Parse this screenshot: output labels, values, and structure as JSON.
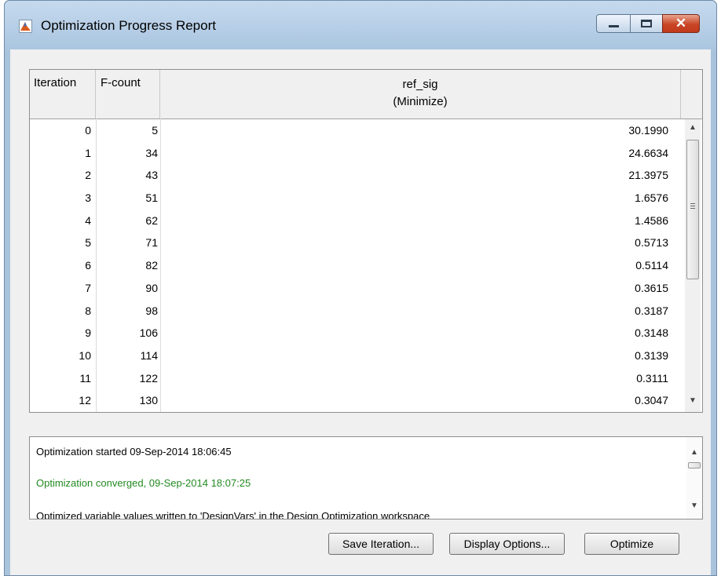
{
  "window": {
    "title": "Optimization Progress Report",
    "title_icon": "matlab-logo-icon",
    "controls": {
      "minimize_icon": "minimize-icon",
      "maximize_icon": "maximize-icon",
      "close_icon": "close-icon",
      "close_glyph": "✕"
    }
  },
  "table": {
    "columns": {
      "iteration": "Iteration",
      "fcount": "F-count",
      "ref_sig": "ref_sig",
      "ref_sig_sub": "(Minimize)"
    },
    "rows": [
      {
        "iteration": "0",
        "fcount": "5",
        "value": "30.1990"
      },
      {
        "iteration": "1",
        "fcount": "34",
        "value": "24.6634"
      },
      {
        "iteration": "2",
        "fcount": "43",
        "value": "21.3975"
      },
      {
        "iteration": "3",
        "fcount": "51",
        "value": "1.6576"
      },
      {
        "iteration": "4",
        "fcount": "62",
        "value": "1.4586"
      },
      {
        "iteration": "5",
        "fcount": "71",
        "value": "0.5713"
      },
      {
        "iteration": "6",
        "fcount": "82",
        "value": "0.5114"
      },
      {
        "iteration": "7",
        "fcount": "90",
        "value": "0.3615"
      },
      {
        "iteration": "8",
        "fcount": "98",
        "value": "0.3187"
      },
      {
        "iteration": "9",
        "fcount": "106",
        "value": "0.3148"
      },
      {
        "iteration": "10",
        "fcount": "114",
        "value": "0.3139"
      },
      {
        "iteration": "11",
        "fcount": "122",
        "value": "0.3111"
      },
      {
        "iteration": "12",
        "fcount": "130",
        "value": "0.3047"
      }
    ],
    "scrollbar": {
      "up_icon": "scroll-up-icon",
      "down_icon": "scroll-down-icon",
      "up_glyph": "▲",
      "down_glyph": "▼"
    }
  },
  "log": {
    "lines": [
      {
        "text": "Optimization started 09-Sep-2014 18:06:45",
        "color": "#000000"
      },
      {
        "text": "Optimization converged, 09-Sep-2014 18:07:25",
        "color": "#238a23"
      },
      {
        "text": "Optimized variable values written to 'DesignVars' in the Design Optimization workspace",
        "color": "#000000"
      }
    ]
  },
  "buttons": {
    "save_iteration": "Save Iteration...",
    "display_options": "Display Options...",
    "optimize": "Optimize"
  }
}
